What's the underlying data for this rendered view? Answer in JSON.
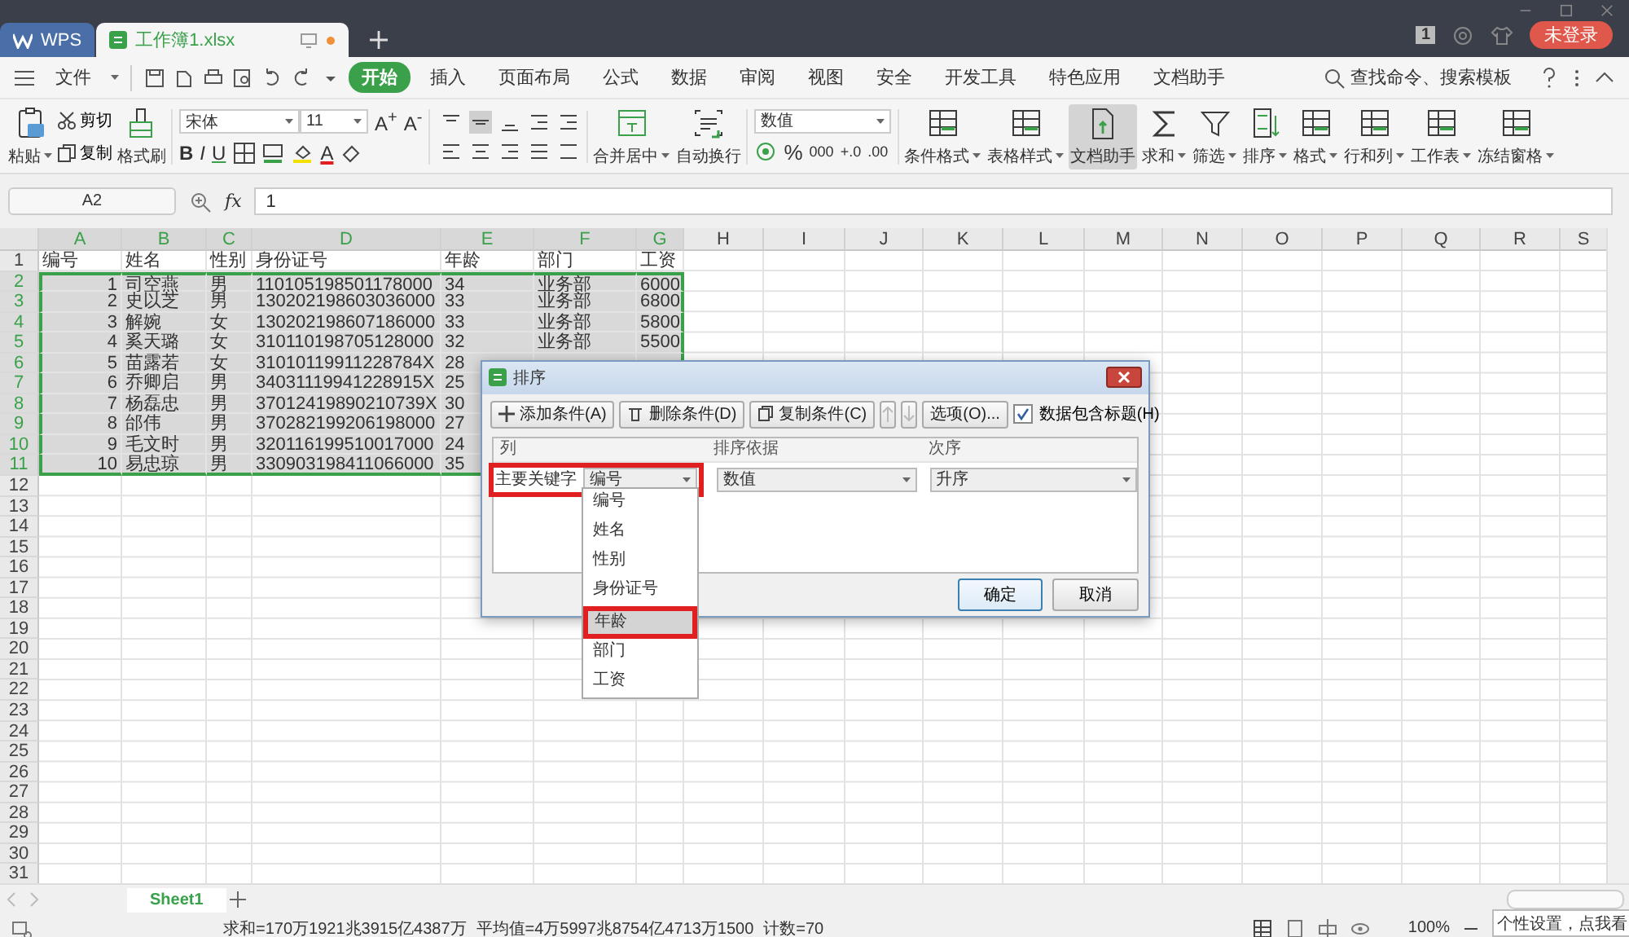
{
  "title_bar": {
    "tabs": [
      {
        "kind": "home",
        "label": "WPS",
        "selected": false
      },
      {
        "kind": "doc",
        "label": "工作簿1.xlsx",
        "selected": true
      }
    ],
    "badge": "1",
    "login": "未登录"
  },
  "menu": {
    "file": "文件",
    "tabs": [
      {
        "label": "开始",
        "selected": true
      },
      {
        "label": "插入",
        "selected": false
      },
      {
        "label": "页面布局",
        "selected": false
      },
      {
        "label": "公式",
        "selected": false
      },
      {
        "label": "数据",
        "selected": false
      },
      {
        "label": "审阅",
        "selected": false
      },
      {
        "label": "视图",
        "selected": false
      },
      {
        "label": "安全",
        "selected": false
      },
      {
        "label": "开发工具",
        "selected": false
      },
      {
        "label": "特色应用",
        "selected": false
      },
      {
        "label": "文档助手",
        "selected": false
      }
    ],
    "search": "查找命令、搜索模板"
  },
  "ribbon": [
    {
      "kind": "big",
      "label": "粘贴",
      "caret": true,
      "selected": false
    },
    {
      "kind": "stack",
      "items": [
        "剪切",
        "复制"
      ]
    },
    {
      "kind": "big",
      "label": "格式刷",
      "caret": false,
      "selected": false
    },
    {
      "kind": "font",
      "font": "宋体",
      "size": "11",
      "size_buttons": [
        "A$^{+}$",
        "A$^{-}$"
      ],
      "style_buttons": [
        "B",
        "I",
        "U"
      ],
      "color_button": "A"
    },
    {
      "kind": "align"
    },
    {
      "kind": "big",
      "label": "合并居中",
      "caret": true,
      "selected": false
    },
    {
      "kind": "big",
      "label": "自动换行",
      "caret": false,
      "selected": false
    },
    {
      "kind": "number",
      "format": "数值",
      "buttons": [
        "%",
        "000",
        "+.0",
        ".00"
      ]
    },
    {
      "kind": "big",
      "label": "条件格式",
      "caret": true,
      "selected": false
    },
    {
      "kind": "big",
      "label": "表格样式",
      "caret": true,
      "selected": false
    },
    {
      "kind": "big",
      "label": "文档助手",
      "caret": false,
      "selected": true
    },
    {
      "kind": "big",
      "label": "求和",
      "caret": true,
      "selected": false
    },
    {
      "kind": "big",
      "label": "筛选",
      "caret": true,
      "selected": false
    },
    {
      "kind": "big",
      "label": "排序",
      "caret": true,
      "selected": false
    },
    {
      "kind": "big",
      "label": "格式",
      "caret": true,
      "selected": false
    },
    {
      "kind": "big",
      "label": "行和列",
      "caret": true,
      "selected": false
    },
    {
      "kind": "big",
      "label": "工作表",
      "caret": true,
      "selected": false
    },
    {
      "kind": "big",
      "label": "冻结窗格",
      "caret": true,
      "selected": false
    }
  ],
  "formula_bar": {
    "name_box": "A2",
    "fx": "fx",
    "value": "1"
  },
  "sheet": {
    "columns": [
      {
        "label": "A",
        "selected": true
      },
      {
        "label": "B",
        "selected": true
      },
      {
        "label": "C",
        "selected": true
      },
      {
        "label": "D",
        "selected": true
      },
      {
        "label": "E",
        "selected": true
      },
      {
        "label": "F",
        "selected": true
      },
      {
        "label": "G",
        "selected": true
      },
      {
        "label": "H",
        "selected": false
      },
      {
        "label": "I",
        "selected": false
      },
      {
        "label": "J",
        "selected": false
      },
      {
        "label": "K",
        "selected": false
      },
      {
        "label": "L",
        "selected": false
      },
      {
        "label": "M",
        "selected": false
      },
      {
        "label": "N",
        "selected": false
      },
      {
        "label": "O",
        "selected": false
      },
      {
        "label": "P",
        "selected": false
      },
      {
        "label": "Q",
        "selected": false
      },
      {
        "label": "R",
        "selected": false
      },
      {
        "label": "S",
        "selected": false
      }
    ],
    "rows": [
      {
        "number": "1",
        "kind": "header",
        "selected": false,
        "cells": [
          "编号",
          "姓名",
          "性别",
          "身份证号",
          "年龄",
          "部门",
          "工资"
        ]
      },
      {
        "number": "2",
        "kind": "data",
        "selected": true,
        "cells": [
          "1",
          "司空燕",
          "男",
          "110105198501178000",
          "34",
          "业务部",
          "6000"
        ]
      },
      {
        "number": "3",
        "kind": "data",
        "selected": true,
        "cells": [
          "2",
          "史以芝",
          "男",
          "130202198603036000",
          "33",
          "业务部",
          "6800"
        ]
      },
      {
        "number": "4",
        "kind": "data",
        "selected": true,
        "cells": [
          "3",
          "解婉",
          "女",
          "130202198607186000",
          "33",
          "业务部",
          "5800"
        ]
      },
      {
        "number": "5",
        "kind": "data",
        "selected": true,
        "cells": [
          "4",
          "奚天璐",
          "女",
          "310110198705128000",
          "32",
          "业务部",
          "5500"
        ]
      },
      {
        "number": "6",
        "kind": "data",
        "selected": true,
        "cells": [
          "5",
          "苗露若",
          "女",
          "31010119911228784X",
          "28"
        ]
      },
      {
        "number": "7",
        "kind": "data",
        "selected": true,
        "cells": [
          "6",
          "乔卿启",
          "男",
          "34031119941228915X",
          "25"
        ]
      },
      {
        "number": "8",
        "kind": "data",
        "selected": true,
        "cells": [
          "7",
          "杨磊忠",
          "男",
          "37012419890210739X",
          "30"
        ]
      },
      {
        "number": "9",
        "kind": "data",
        "selected": true,
        "cells": [
          "8",
          "邰伟",
          "男",
          "370282199206198000",
          "27"
        ]
      },
      {
        "number": "10",
        "kind": "data",
        "selected": true,
        "cells": [
          "9",
          "毛文时",
          "男",
          "320116199510017000",
          "24"
        ]
      },
      {
        "number": "11",
        "kind": "data",
        "selected": true,
        "cells": [
          "10",
          "易忠琼",
          "男",
          "330903198411066000",
          "35"
        ]
      }
    ],
    "empty_rows": [
      "12",
      "13",
      "14",
      "15",
      "16",
      "17",
      "18",
      "19",
      "20",
      "21",
      "22",
      "23",
      "24",
      "25",
      "26",
      "27",
      "28",
      "29",
      "30",
      "31"
    ]
  },
  "sort_dialog": {
    "title": "排序",
    "buttons": [
      "添加条件(A)",
      "删除条件(D)",
      "复制条件(C)"
    ],
    "options": "选项(O)...",
    "header_checkbox": {
      "label": "数据包含标题(H)",
      "checked": true
    },
    "columns": [
      "列",
      "排序依据",
      "次序"
    ],
    "condition": {
      "label": "主要关键字",
      "key": "编号",
      "basis": "数值",
      "order": "升序",
      "annotated": true
    },
    "dropdown": [
      {
        "label": "编号",
        "selected": false,
        "annotated": false
      },
      {
        "label": "姓名",
        "selected": false,
        "annotated": false
      },
      {
        "label": "性别",
        "selected": false,
        "annotated": false
      },
      {
        "label": "身份证号",
        "selected": false,
        "annotated": false
      },
      {
        "label": "年龄",
        "selected": true,
        "annotated": true
      },
      {
        "label": "部门",
        "selected": false,
        "annotated": false
      },
      {
        "label": "工资",
        "selected": false,
        "annotated": false
      }
    ],
    "ok": "确定",
    "cancel": "取消"
  },
  "sheet_tabs": [
    {
      "label": "Sheet1",
      "selected": true
    }
  ],
  "status_bar": {
    "sum": "求和=170万1921兆3915亿4387万",
    "average": "平均值=4万5997兆8754亿4713万1500",
    "count": "计数=70",
    "zoom": "100%"
  },
  "tooltip": "个性设置，点我看"
}
